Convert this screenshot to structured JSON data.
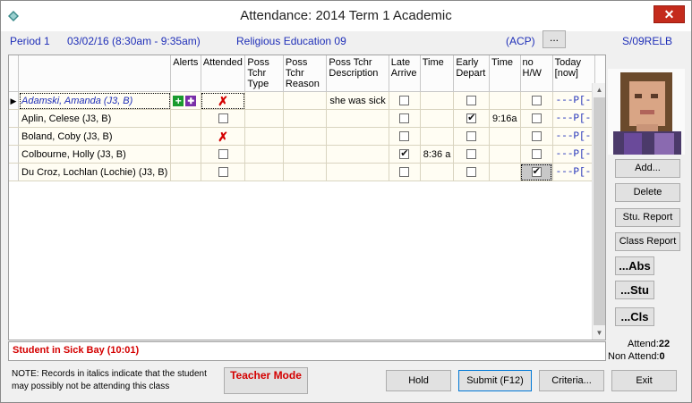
{
  "window": {
    "title": "Attendance:  2014 Term 1 Academic",
    "close_label": "✕"
  },
  "info": {
    "period": "Period 1",
    "datetime": "03/02/16 (8:30am - 9:35am)",
    "subject": "Religious Education 09",
    "acp": "(ACP)",
    "more_label": "...",
    "class_code": "S/09RELB"
  },
  "grid": {
    "headers": {
      "alerts": "Alerts",
      "attended": "Attended",
      "poss_type": "Poss Tchr Type",
      "poss_reason": "Poss Tchr Reason",
      "poss_desc": "Poss Tchr Description",
      "late_arrive": "Late Arrive",
      "time1": "Time",
      "early_depart": "Early Depart",
      "time2": "Time",
      "no_hw": "no H/W",
      "today": "Today [now]"
    },
    "rows": [
      {
        "name": "Adamski, Amanda (J3, B)",
        "description": "she was sick",
        "time1": "",
        "time2": "",
        "today": "---P[-"
      },
      {
        "name": "Aplin, Celese (J3, B)",
        "description": "",
        "time1": "",
        "time2": "9:16a",
        "today": "---P[-"
      },
      {
        "name": "Boland, Coby (J3, B)",
        "description": "",
        "time1": "",
        "time2": "",
        "today": "---P[-"
      },
      {
        "name": "Colbourne, Holly (J3, B)",
        "description": "",
        "time1": "8:36 a",
        "time2": "",
        "today": "---P[-"
      },
      {
        "name": "Du Croz, Lochlan (Lochie) (J3, B)",
        "description": "",
        "time1": "",
        "time2": "",
        "today": "---P[-"
      }
    ]
  },
  "side": {
    "add": "Add...",
    "delete": "Delete",
    "stu_report": "Stu. Report",
    "class_report": "Class Report",
    "abs": "...Abs",
    "stu": "...Stu",
    "cls": "...Cls",
    "attend_label": "Attend:",
    "attend_value": "22",
    "non_attend_label": "Non Attend:",
    "non_attend_value": "0"
  },
  "status": {
    "text": "Student in Sick Bay (10:01)"
  },
  "note": {
    "text": "NOTE:  Records in italics indicate that the student may possibly not be attending this class"
  },
  "buttons": {
    "teacher_mode": "Teacher Mode",
    "hold": "Hold",
    "submit": "Submit (F12)",
    "criteria": "Criteria...",
    "exit": "Exit"
  },
  "colors": {
    "accent_blue": "#1f2fb8",
    "alert_red": "#d40000"
  },
  "icons": [
    "diamond-app-icon",
    "close-icon",
    "row-pointer-icon",
    "medical-cross-icon",
    "medical-alert-icon",
    "x-mark-icon",
    "checkbox-icon",
    "scroll-up-icon",
    "scroll-down-icon"
  ]
}
